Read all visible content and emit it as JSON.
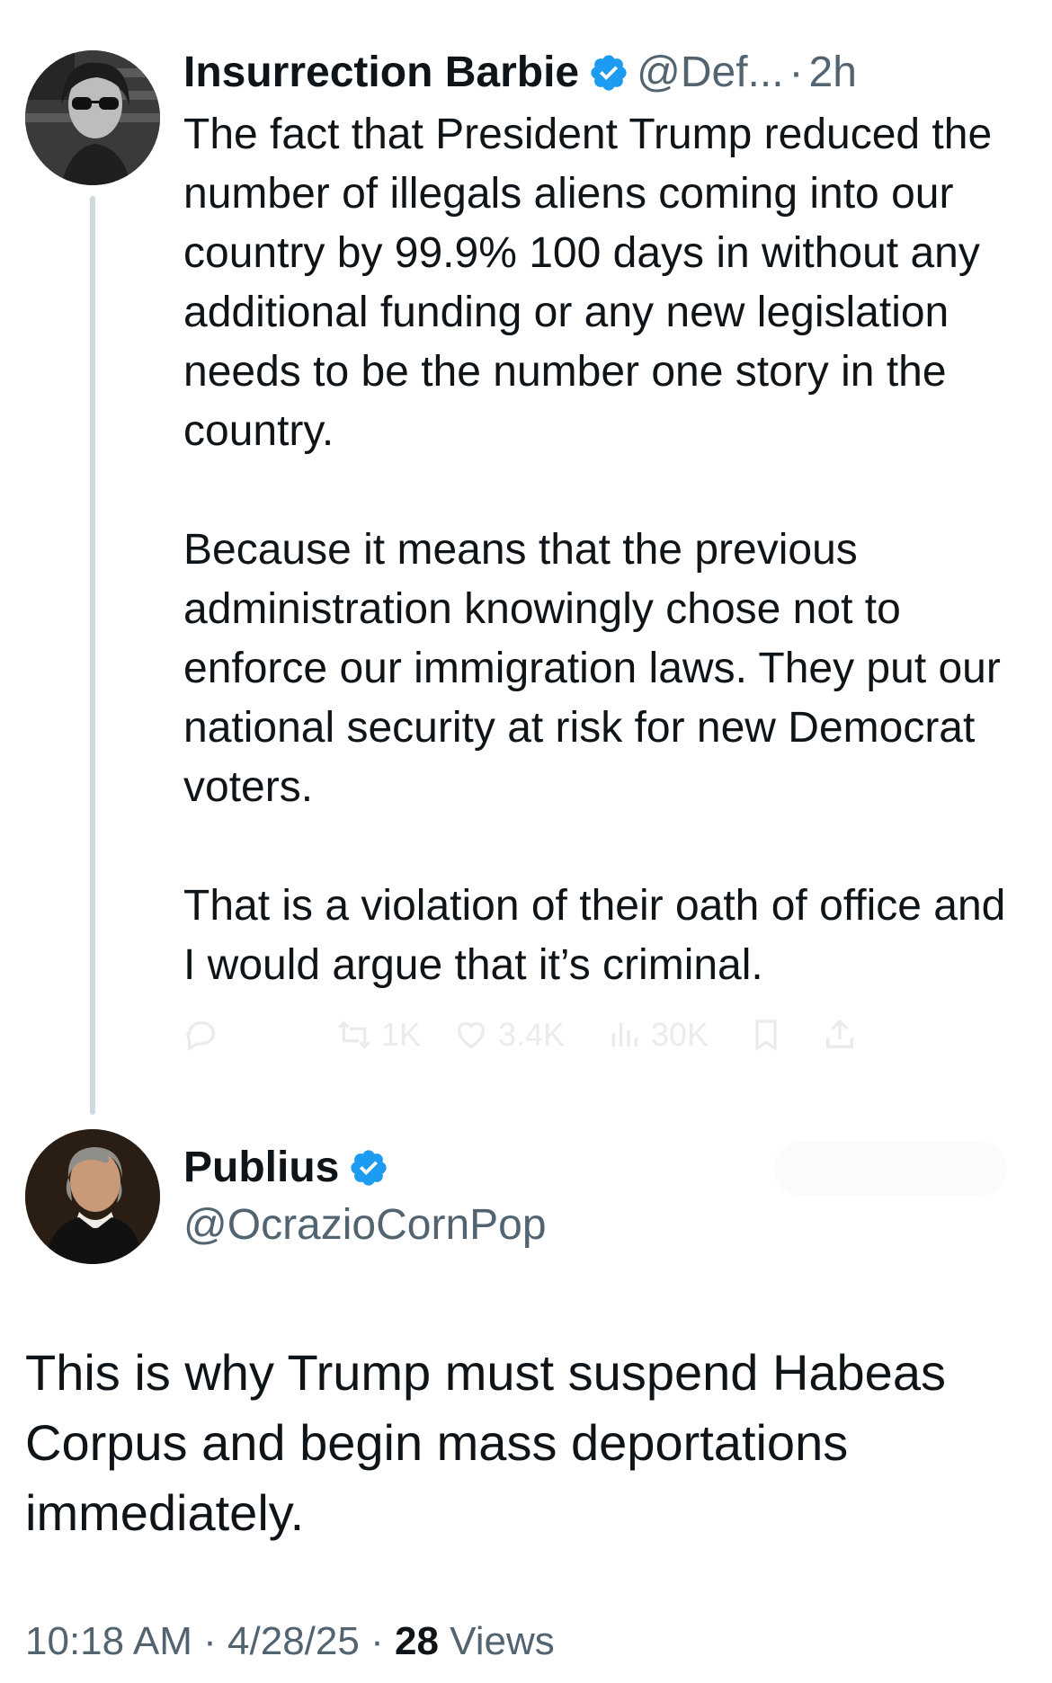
{
  "parent_tweet": {
    "display_name": "Insurrection Barbie",
    "handle": "@Def...",
    "separator": "·",
    "time_ago": "2h",
    "verified": true,
    "paragraphs": [
      "The fact that President Trump reduced the number of illegals aliens coming into our country by 99.9% 100 days in without any additional funding or any new legislation needs to be the number one story in the country.",
      "Because it means that the previous administration knowingly chose not to enforce our immigration laws. They put our national security at risk for new Democrat voters.",
      "That is a violation of their oath of office and I would argue that it’s criminal."
    ],
    "actions": {
      "reposts": "1K",
      "likes": "3.4K",
      "views": "30K"
    }
  },
  "reply_tweet": {
    "display_name": "Publius",
    "handle": "@OcrazioCornPop",
    "verified": true,
    "text": "This is why Trump must suspend Habeas Corpus and begin mass deportations immediately.",
    "time": "10:18 AM",
    "date": "4/28/25",
    "separator": "·",
    "views_count": "28",
    "views_label": "Views"
  },
  "colors": {
    "verified_blue": "#1d9bf0",
    "text_primary": "#0f1419",
    "text_secondary": "#536471",
    "thread_line": "#cfd9de"
  }
}
